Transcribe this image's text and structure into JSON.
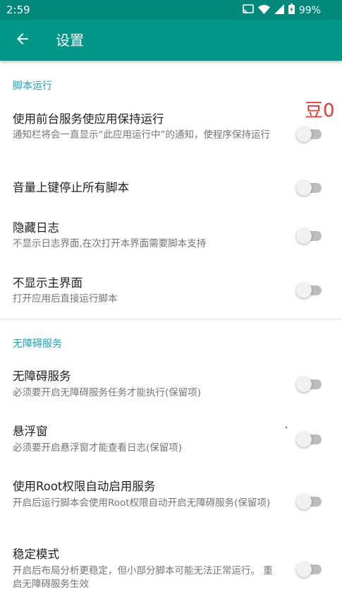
{
  "status_bar": {
    "time": "2:59",
    "battery": "99%",
    "icons": [
      "cast-icon",
      "wifi-icon",
      "signal-icon",
      "battery-icon"
    ]
  },
  "toolbar": {
    "back_icon": "arrow-left-icon",
    "title": "设置"
  },
  "sections": [
    {
      "header": "脚本运行",
      "items": [
        {
          "title": "使用前台服务使应用保持运行",
          "summary": "通知栏将会一直显示“此应用运行中”的通知，使程序保持运行",
          "enabled": false
        },
        {
          "title": "音量上键停止所有脚本",
          "summary": "",
          "enabled": false
        },
        {
          "title": "隐藏日志",
          "summary": "不显示日志界面,在次打开本界面需要脚本支持",
          "enabled": false
        },
        {
          "title": "不显示主界面",
          "summary": "打开应用后直接运行脚本",
          "enabled": false
        }
      ]
    },
    {
      "header": "无障碍服务",
      "items": [
        {
          "title": "无障碍服务",
          "summary": "必须要开启无障碍服务任务才能执行(保留项)",
          "enabled": false
        },
        {
          "title": "悬浮窗",
          "summary": "必须要开启悬浮窗才能查看日志(保留项)",
          "enabled": false
        },
        {
          "title": "使用Root权限自动启用服务",
          "summary": "开启后运行脚本会使用Root权限自动开启无障碍服务(保留项)",
          "enabled": false
        },
        {
          "title": "稳定模式",
          "summary": "开启后布局分析更稳定，但小部分脚本可能无法正常运行。 重启无障碍服务生效",
          "enabled": false
        }
      ]
    }
  ],
  "overlay": {
    "text": "豆0",
    "color": "#E53935"
  },
  "colors": {
    "primary": "#009688",
    "primary_dark": "#00897B",
    "section_header": "#16A6C9",
    "toggle_track_off": "#BDBDBD",
    "toggle_thumb_off": "#F1F1F1"
  }
}
